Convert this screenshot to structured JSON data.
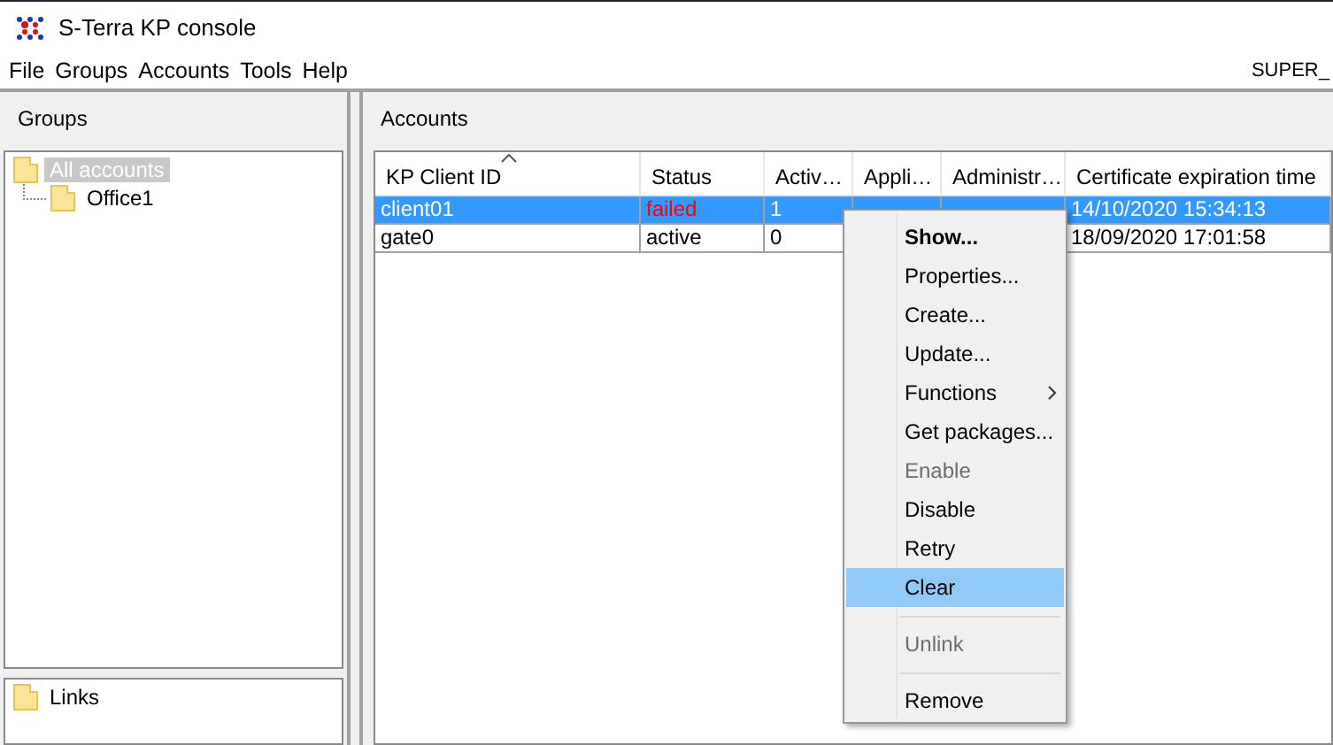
{
  "window": {
    "title": "S-Terra KP console"
  },
  "menu_bar": [
    "File",
    "Groups",
    "Accounts",
    "Tools",
    "Help"
  ],
  "user": "SUPER_",
  "groups_panel": {
    "title": "Groups",
    "tree": [
      {
        "label": "All accounts",
        "selected": true,
        "children": [
          {
            "label": "Office1",
            "selected": false
          }
        ]
      }
    ]
  },
  "links_panel": {
    "items": [
      {
        "label": "Links"
      }
    ]
  },
  "accounts_panel": {
    "title": "Accounts",
    "table": {
      "columns": [
        {
          "label": "KP Client ID",
          "sorted": true
        },
        {
          "label": "Status",
          "sorted": false
        },
        {
          "label": "Activ…",
          "sorted": false
        },
        {
          "label": "Appli…",
          "sorted": false
        },
        {
          "label": "Administr…",
          "sorted": false
        },
        {
          "label": "Certificate expiration time",
          "sorted": false
        }
      ],
      "rows": [
        {
          "selected": true,
          "color": "#ff0000",
          "client_id": "client01",
          "status": "failed",
          "active": "1",
          "certificate_expiration": "14/10/2020 15:34:13"
        },
        {
          "selected": false,
          "color": "#000000",
          "client_id": "gate0",
          "status": "active",
          "active": "0",
          "certificate_expiration": "18/09/2020 17:01:58"
        }
      ]
    }
  },
  "context_menu": {
    "items": [
      {
        "kind": "item",
        "label": "Show...",
        "bold": true,
        "disabled": false,
        "selected": false,
        "submenu": false
      },
      {
        "kind": "item",
        "label": "Properties...",
        "bold": false,
        "disabled": false,
        "selected": false,
        "submenu": false
      },
      {
        "kind": "item",
        "label": "Create...",
        "bold": false,
        "disabled": false,
        "selected": false,
        "submenu": false
      },
      {
        "kind": "item",
        "label": "Update...",
        "bold": false,
        "disabled": false,
        "selected": false,
        "submenu": false
      },
      {
        "kind": "item",
        "label": "Functions",
        "bold": false,
        "disabled": false,
        "selected": false,
        "submenu": true
      },
      {
        "kind": "item",
        "label": "Get packages...",
        "bold": false,
        "disabled": false,
        "selected": false,
        "submenu": false
      },
      {
        "kind": "item",
        "label": "Enable",
        "bold": false,
        "disabled": true,
        "selected": false,
        "submenu": false
      },
      {
        "kind": "item",
        "label": "Disable",
        "bold": false,
        "disabled": false,
        "selected": false,
        "submenu": false
      },
      {
        "kind": "item",
        "label": "Retry",
        "bold": false,
        "disabled": false,
        "selected": false,
        "submenu": false
      },
      {
        "kind": "item",
        "label": "Clear",
        "bold": false,
        "disabled": false,
        "selected": true,
        "submenu": false
      },
      {
        "kind": "separator"
      },
      {
        "kind": "item",
        "label": "Unlink",
        "bold": false,
        "disabled": true,
        "selected": false,
        "submenu": false
      },
      {
        "kind": "separator"
      },
      {
        "kind": "item",
        "label": "Remove",
        "bold": false,
        "disabled": false,
        "selected": false,
        "submenu": false
      }
    ]
  }
}
